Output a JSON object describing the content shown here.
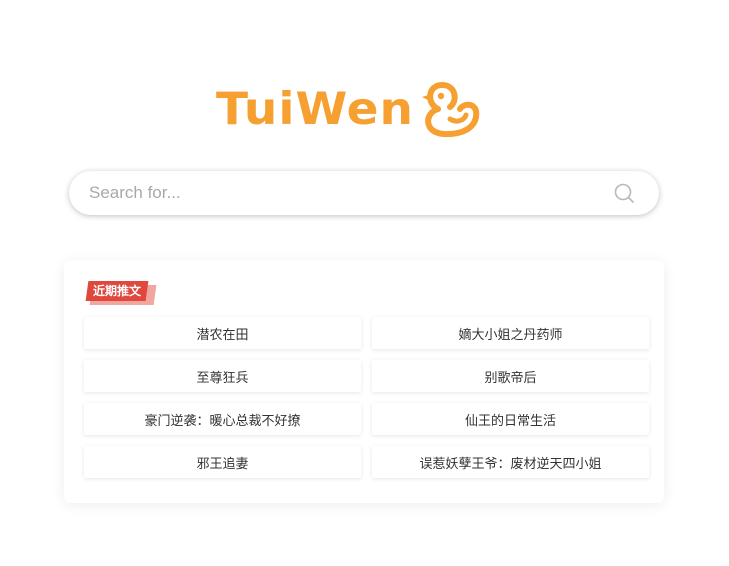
{
  "logo": {
    "text": "TuiWen",
    "icon": "duck-icon",
    "color": "#f5a030"
  },
  "search": {
    "placeholder": "Search for...",
    "value": "",
    "icon": "search-icon"
  },
  "recent": {
    "badge_label": "近期推文",
    "badge_color": "#e0473d",
    "items": [
      {
        "title": "潜农在田"
      },
      {
        "title": "嫡大小姐之丹药师"
      },
      {
        "title": "至尊狂兵"
      },
      {
        "title": "别歌帝后"
      },
      {
        "title": "豪门逆袭：暖心总裁不好撩"
      },
      {
        "title": "仙王的日常生活"
      },
      {
        "title": "邪王追妻"
      },
      {
        "title": "误惹妖孽王爷：废材逆天四小姐"
      }
    ]
  }
}
